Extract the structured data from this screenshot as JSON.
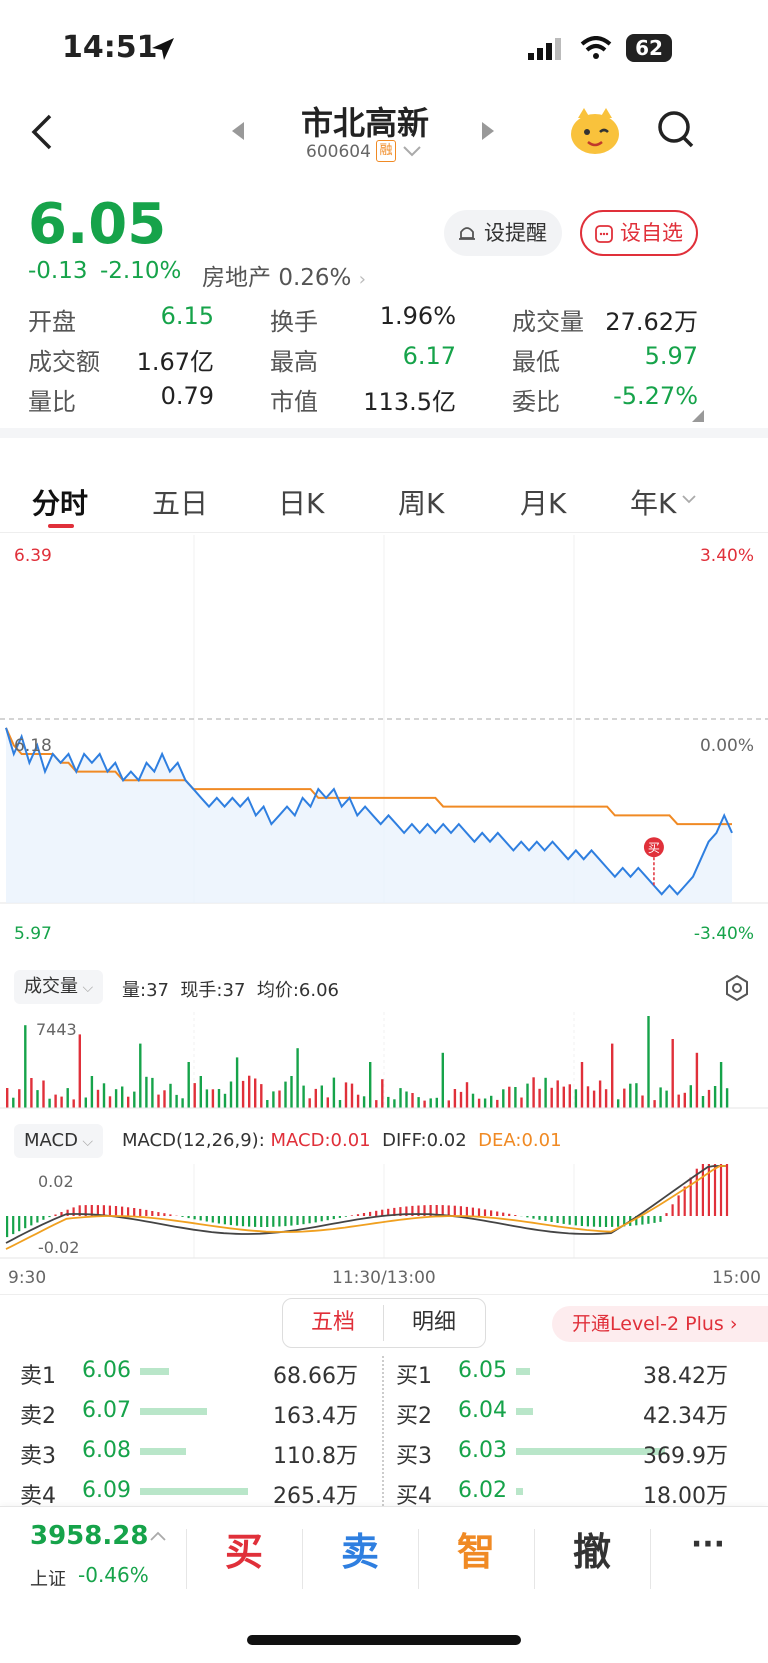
{
  "status": {
    "time": "14:51",
    "battery": "62"
  },
  "nav": {
    "title": "市北高新",
    "code": "600604",
    "badge": "融"
  },
  "quote": {
    "price": "6.05",
    "change": "-0.13",
    "change_pct": "-2.10%",
    "sector": "房地产",
    "sector_pct": "0.26%",
    "alert_label": "设提醒",
    "watch_label": "设自选"
  },
  "stats": [
    {
      "label": "开盘",
      "value": "6.15",
      "color": "dn"
    },
    {
      "label": "换手",
      "value": "1.96%",
      "color": "neutral"
    },
    {
      "label": "成交量",
      "value": "27.62万",
      "color": "neutral"
    },
    {
      "label": "成交额",
      "value": "1.67亿",
      "color": "neutral"
    },
    {
      "label": "最高",
      "value": "6.17",
      "color": "dn"
    },
    {
      "label": "最低",
      "value": "5.97",
      "color": "dn"
    },
    {
      "label": "量比",
      "value": "0.79",
      "color": "neutral"
    },
    {
      "label": "市值",
      "value": "113.5亿",
      "color": "neutral"
    },
    {
      "label": "委比",
      "value": "-5.27%",
      "color": "dn"
    }
  ],
  "tabs": [
    "分时",
    "五日",
    "日K",
    "周K",
    "月K",
    "年K"
  ],
  "chart_data": {
    "type": "line",
    "title": "",
    "y_max": "6.39",
    "y_mid": "6.18",
    "y_min": "5.97",
    "pct_max": "3.40%",
    "pct_mid": "0.00%",
    "pct_min": "-3.40%",
    "ylim": [
      5.97,
      6.39
    ],
    "x_ticks": [
      "9:30",
      "11:30/13:00",
      "15:00"
    ],
    "buy_marker": "买",
    "series": [
      {
        "name": "price",
        "color": "#2f7fe0",
        "values": [
          6.17,
          6.14,
          6.16,
          6.13,
          6.15,
          6.12,
          6.14,
          6.13,
          6.14,
          6.12,
          6.14,
          6.13,
          6.14,
          6.12,
          6.13,
          6.11,
          6.12,
          6.11,
          6.13,
          6.12,
          6.14,
          6.12,
          6.13,
          6.11,
          6.1,
          6.09,
          6.08,
          6.09,
          6.08,
          6.09,
          6.08,
          6.09,
          6.07,
          6.08,
          6.06,
          6.07,
          6.08,
          6.07,
          6.09,
          6.08,
          6.1,
          6.09,
          6.1,
          6.08,
          6.09,
          6.07,
          6.08,
          6.07,
          6.06,
          6.07,
          6.06,
          6.05,
          6.06,
          6.05,
          6.06,
          6.05,
          6.06,
          6.05,
          6.06,
          6.05,
          6.04,
          6.05,
          6.04,
          6.05,
          6.04,
          6.03,
          6.04,
          6.03,
          6.04,
          6.03,
          6.04,
          6.03,
          6.02,
          6.03,
          6.02,
          6.03,
          6.02,
          6.01,
          6.0,
          6.01,
          6.0,
          6.01,
          6.0,
          5.99,
          5.98,
          5.99,
          5.98,
          5.99,
          6.0,
          6.02,
          6.04,
          6.05,
          6.07,
          6.05
        ]
      },
      {
        "name": "avg",
        "color": "#f08a24",
        "values": [
          6.17,
          6.15,
          6.14,
          6.14,
          6.14,
          6.14,
          6.14,
          6.13,
          6.13,
          6.12,
          6.12,
          6.12,
          6.12,
          6.12,
          6.12,
          6.11,
          6.11,
          6.11,
          6.11,
          6.11,
          6.11,
          6.11,
          6.11,
          6.11,
          6.1,
          6.1,
          6.1,
          6.1,
          6.1,
          6.1,
          6.1,
          6.1,
          6.1,
          6.1,
          6.1,
          6.1,
          6.1,
          6.1,
          6.1,
          6.1,
          6.09,
          6.09,
          6.09,
          6.09,
          6.09,
          6.09,
          6.09,
          6.09,
          6.09,
          6.09,
          6.09,
          6.09,
          6.09,
          6.09,
          6.09,
          6.09,
          6.08,
          6.08,
          6.08,
          6.08,
          6.08,
          6.08,
          6.08,
          6.08,
          6.08,
          6.08,
          6.08,
          6.08,
          6.08,
          6.08,
          6.08,
          6.08,
          6.08,
          6.08,
          6.08,
          6.08,
          6.08,
          6.08,
          6.07,
          6.07,
          6.07,
          6.07,
          6.07,
          6.07,
          6.07,
          6.07,
          6.06,
          6.06,
          6.06,
          6.06,
          6.06,
          6.06,
          6.06,
          6.06
        ]
      }
    ]
  },
  "volume": {
    "label": "成交量",
    "vol": "量:37",
    "cur": "现手:37",
    "avg": "均价:6.06",
    "max_label": "7443"
  },
  "macd": {
    "label": "MACD",
    "params": "MACD(12,26,9):",
    "macd": "MACD:0.01",
    "diff": "DIFF:0.02",
    "dea": "DEA:0.01",
    "top": "0.02",
    "bottom": "-0.02"
  },
  "orderbook": {
    "tab_active": "五档",
    "tab_other": "明细",
    "promo": "开通Level-2 Plus",
    "sells": [
      {
        "label": "卖1",
        "price": "6.06",
        "vol": "68.66万",
        "bar": 0.12
      },
      {
        "label": "卖2",
        "price": "6.07",
        "vol": "163.4万",
        "bar": 0.28
      },
      {
        "label": "卖3",
        "price": "6.08",
        "vol": "110.8万",
        "bar": 0.19
      },
      {
        "label": "卖4",
        "price": "6.09",
        "vol": "265.4万",
        "bar": 0.45
      }
    ],
    "buys": [
      {
        "label": "买1",
        "price": "6.05",
        "vol": "38.42万",
        "bar": 0.06
      },
      {
        "label": "买2",
        "price": "6.04",
        "vol": "42.34万",
        "bar": 0.07
      },
      {
        "label": "买3",
        "price": "6.03",
        "vol": "369.9万",
        "bar": 0.62
      },
      {
        "label": "买4",
        "price": "6.02",
        "vol": "18.00万",
        "bar": 0.03
      }
    ]
  },
  "bottom": {
    "index_value": "3958.28",
    "index_name": "上证",
    "index_pct": "-0.46%",
    "buy": "买",
    "sell": "卖",
    "smart": "智",
    "cancel": "撤",
    "more": "···"
  }
}
